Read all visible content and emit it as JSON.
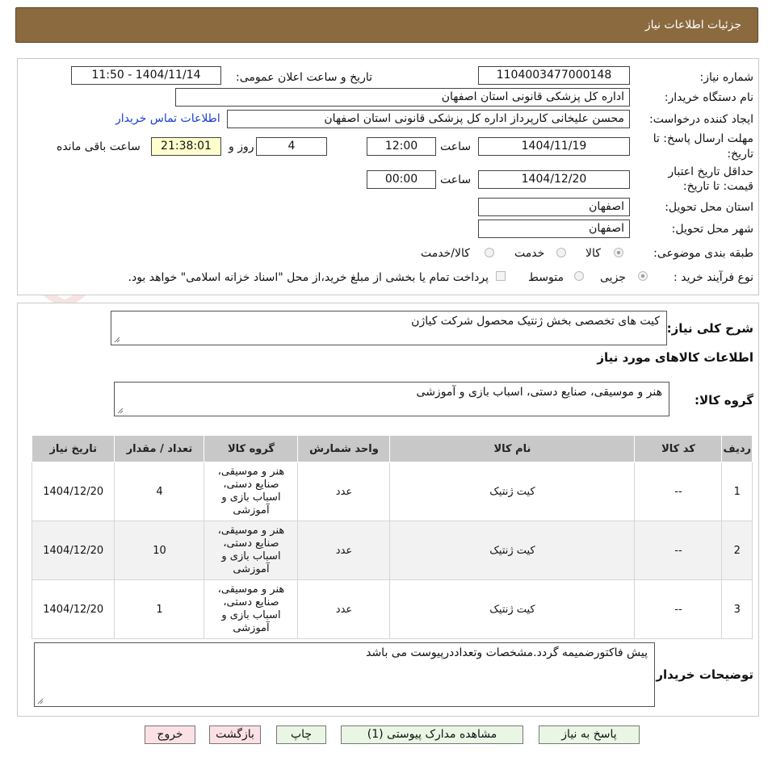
{
  "header": {
    "title": "جزئیات اطلاعات نیاز"
  },
  "form": {
    "need_number_label": "شماره نیاز:",
    "need_number": "1104003477000148",
    "announce_label": "تاریخ و ساعت اعلان عمومی:",
    "announce_value": "1404/11/14 - 11:50",
    "buyer_org_label": "نام دستگاه خریدار:",
    "buyer_org": "اداره کل پزشکی قانونی استان اصفهان",
    "requester_label": "ایجاد کننده درخواست:",
    "requester": "محسن علیخانی کارپرداز اداره کل پزشکی قانونی استان اصفهان",
    "contact_link": "اطلاعات تماس خریدار",
    "deadline_label": "مهلت ارسال پاسخ: تا تاریخ:",
    "deadline_date": "1404/11/19",
    "time_label": "ساعت",
    "deadline_time": "12:00",
    "days": "4",
    "days_label": "روز و",
    "remaining": "21:38:01",
    "remaining_label": "ساعت باقی مانده",
    "validity_label": "حداقل تاریخ اعتبار قیمت: تا تاریخ:",
    "validity_date": "1404/12/20",
    "validity_time": "00:00",
    "province_label": "استان محل تحویل:",
    "province": "اصفهان",
    "city_label": "شهر محل تحویل:",
    "city": "اصفهان",
    "category_label": "طبقه بندی موضوعی:",
    "category_options": [
      "کالا",
      "خدمت",
      "کالا/خدمت"
    ],
    "category_selected": "کالا",
    "process_label": "نوع فرآیند خرید :",
    "process_options": [
      "جزیی",
      "متوسط"
    ],
    "process_selected": "جزیی",
    "payment_note": "پرداخت تمام یا بخشی از مبلغ خرید،از محل \"اسناد خزانه اسلامی\" خواهد بود."
  },
  "summary": {
    "label": "شرح کلی نیاز:",
    "value": "کیت های تخصصی بخش ژنتیک محصول شرکت کیاژن",
    "goods_info_title": "اطلاعات کالاهای مورد نیاز",
    "group_label": "گروه کالا:",
    "group_value": "هنر و موسیقی، صنایع دستی، اسباب بازی و آموزشی"
  },
  "table": {
    "headers": [
      "ردیف",
      "کد کالا",
      "نام کالا",
      "واحد شمارش",
      "گروه کالا",
      "تعداد / مقدار",
      "تاریخ نیاز"
    ],
    "rows": [
      [
        "1",
        "--",
        "کیت ژنتیک",
        "عدد",
        "هنر و موسیقی، صنایع دستی، اسباب بازی و آموزشی",
        "4",
        "1404/12/20"
      ],
      [
        "2",
        "--",
        "کیت ژنتیک",
        "عدد",
        "هنر و موسیقی، صنایع دستی، اسباب بازی و آموزشی",
        "10",
        "1404/12/20"
      ],
      [
        "3",
        "--",
        "کیت ژنتیک",
        "عدد",
        "هنر و موسیقی، صنایع دستی، اسباب بازی و آموزشی",
        "1",
        "1404/12/20"
      ]
    ]
  },
  "buyer_notes": {
    "label": "توضیحات خریدار:",
    "value": "پیش فاکتورضمیمه گردد.مشخصات وتعداددرپیوست می باشد"
  },
  "buttons": {
    "reply": "پاسخ به نیاز",
    "attachments": "مشاهده مدارک پیوستی (1)",
    "print": "چاپ",
    "back": "بازگشت",
    "exit": "خروج"
  },
  "watermark": {
    "text": "AriaTender.neT"
  }
}
